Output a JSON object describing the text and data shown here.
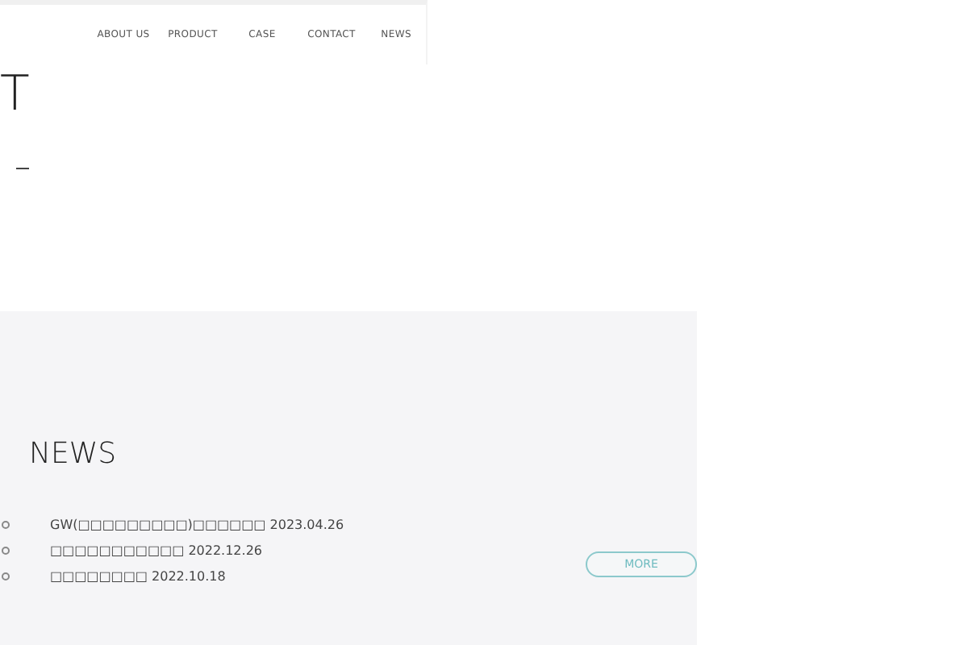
{
  "nav": {
    "items": [
      {
        "label": "ABOUT US"
      },
      {
        "label": "PRODUCT"
      },
      {
        "label": "CASE"
      },
      {
        "label": "CONTACT"
      },
      {
        "label": "NEWS"
      }
    ]
  },
  "hero": {
    "title": "T"
  },
  "news": {
    "heading": "NEWS",
    "items": [
      {
        "title": "GW(□□□□□□□□□)□□□□□□",
        "date": "2023.04.26"
      },
      {
        "title": "□□□□□□□□□□□",
        "date": "2022.12.26"
      },
      {
        "title": "□□□□□□□□",
        "date": "2022.10.18"
      }
    ],
    "more": "MORE"
  }
}
